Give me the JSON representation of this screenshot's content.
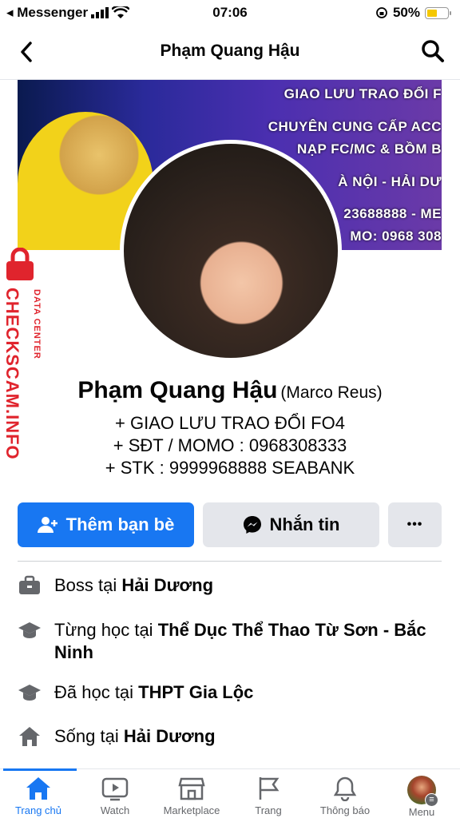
{
  "status_bar": {
    "carrier": "◂ Messenger",
    "time": "07:06",
    "battery": "50%"
  },
  "nav": {
    "title": "Phạm Quang Hậu"
  },
  "cover": {
    "lines": [
      "GIAO LƯU TRAO ĐỔI F",
      "CHUYÊN CUNG CẤP ACC",
      "NẠP FC/MC & BỒM B",
      "À NỘI - HẢI DƯ",
      "23688888 - ME",
      "MO: 0968 308"
    ]
  },
  "watermark": {
    "brand": "CHECKSCAM.INFO",
    "sub": "DATA CENTER"
  },
  "profile": {
    "name": "Phạm Quang Hậu",
    "alternate_name": "(Marco Reus)",
    "bio": [
      "+ GIAO LƯU TRAO ĐỔI FO4",
      "+ SĐT / MOMO : 0968308333",
      "+ STK : 9999968888 SEABANK"
    ]
  },
  "actions": {
    "add_friend": "Thêm bạn bè",
    "message": "Nhắn tin",
    "more": "•••"
  },
  "info": {
    "work_prefix": "Boss tại ",
    "work_place": "Hải Dương",
    "studied1_prefix": "Từng học tại ",
    "studied1_place": "Thể Dục Thể Thao Từ Sơn - Bắc Ninh",
    "studied2_prefix": "Đã học tại ",
    "studied2_place": "THPT Gia Lộc",
    "lives_prefix": "Sống tại ",
    "lives_place": "Hải Dương"
  },
  "tabs": [
    {
      "label": "Trang chủ",
      "icon": "home-icon",
      "active": true
    },
    {
      "label": "Watch",
      "icon": "watch-icon"
    },
    {
      "label": "Marketplace",
      "icon": "marketplace-icon"
    },
    {
      "label": "Trang",
      "icon": "pages-flag-icon"
    },
    {
      "label": "Thông báo",
      "icon": "bell-icon"
    },
    {
      "label": "Menu",
      "icon": "menu-avatar"
    }
  ],
  "colors": {
    "accent": "#1877f2",
    "watermark": "#e0242d"
  }
}
